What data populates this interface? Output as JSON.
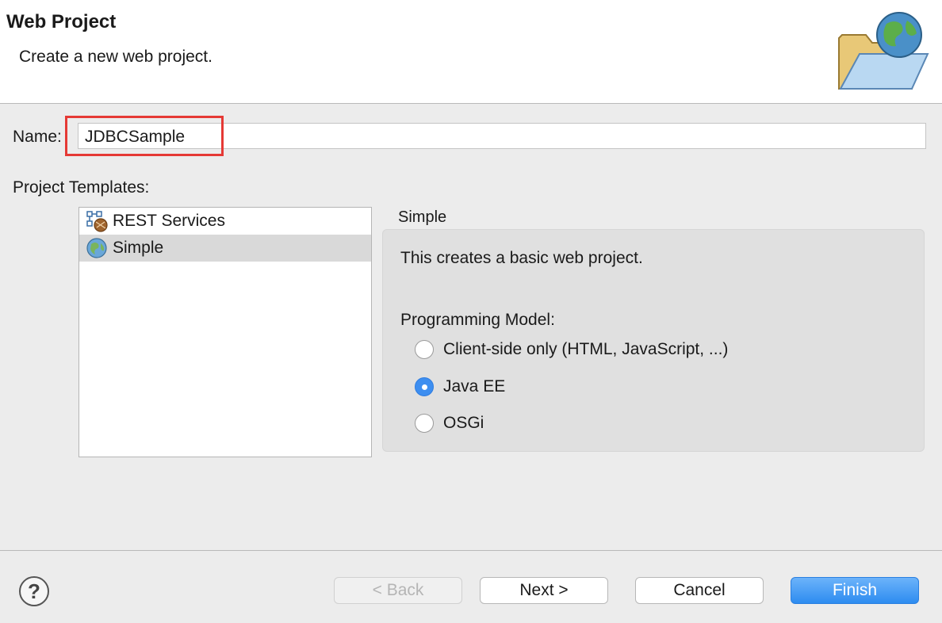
{
  "banner": {
    "title": "Web Project",
    "description": "Create a new web project.",
    "icon": "folder-globe-icon"
  },
  "name_field": {
    "label": "Name:",
    "value": "JDBCSample"
  },
  "templates": {
    "label": "Project Templates:",
    "items": [
      {
        "label": "REST Services",
        "icon": "rest-services-icon",
        "selected": false
      },
      {
        "label": "Simple",
        "icon": "globe-icon",
        "selected": true
      }
    ]
  },
  "detail": {
    "title": "Simple",
    "description": "This creates a basic web project.",
    "programming_model_label": "Programming Model:",
    "options": [
      {
        "label": "Client-side only (HTML, JavaScript, ...)",
        "checked": false
      },
      {
        "label": "Java EE",
        "checked": true
      },
      {
        "label": "OSGi",
        "checked": false
      }
    ]
  },
  "footer": {
    "help": "?",
    "back": "< Back",
    "next": "Next >",
    "cancel": "Cancel",
    "finish": "Finish"
  },
  "colors": {
    "highlight": "#e53935",
    "accent": "#3d8ef0"
  }
}
